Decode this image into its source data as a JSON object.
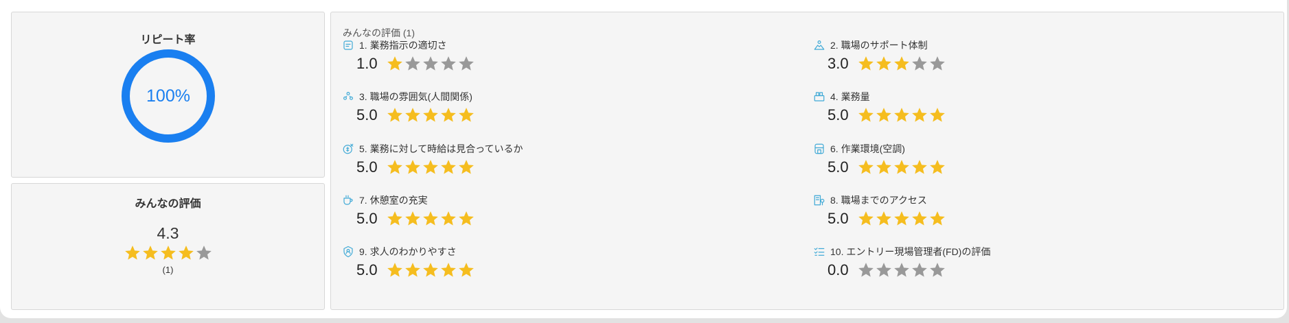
{
  "colors": {
    "accent": "#1a7ff0",
    "star_filled": "#f5bd1f",
    "star_empty": "#999999",
    "icon": "#3fa9d6"
  },
  "repeat": {
    "title": "リピート率",
    "value": "100%"
  },
  "overall": {
    "title": "みんなの評価",
    "score": "4.3",
    "stars_filled": 4,
    "count": "(1)"
  },
  "ratings": {
    "title": "みんなの評価 (1)",
    "items": [
      {
        "label": "1. 業務指示の適切さ",
        "score": "1.0",
        "stars": 1,
        "icon": "note-icon"
      },
      {
        "label": "2. 職場のサポート体制",
        "score": "3.0",
        "stars": 3,
        "icon": "support-icon"
      },
      {
        "label": "3. 職場の雰囲気(人間関係)",
        "score": "5.0",
        "stars": 5,
        "icon": "people-icon"
      },
      {
        "label": "4. 業務量",
        "score": "5.0",
        "stars": 5,
        "icon": "workload-icon"
      },
      {
        "label": "5. 業務に対して時給は見合っているか",
        "score": "5.0",
        "stars": 5,
        "icon": "wage-icon"
      },
      {
        "label": "6. 作業環境(空調)",
        "score": "5.0",
        "stars": 5,
        "icon": "environment-icon"
      },
      {
        "label": "7. 休憩室の充実",
        "score": "5.0",
        "stars": 5,
        "icon": "cup-icon"
      },
      {
        "label": "8. 職場までのアクセス",
        "score": "5.0",
        "stars": 5,
        "icon": "access-icon"
      },
      {
        "label": "9. 求人のわかりやすさ",
        "score": "5.0",
        "stars": 5,
        "icon": "badge-icon"
      },
      {
        "label": "10. エントリー現場管理者(FD)の評価",
        "score": "0.0",
        "stars": 0,
        "icon": "checklist-icon"
      }
    ]
  }
}
